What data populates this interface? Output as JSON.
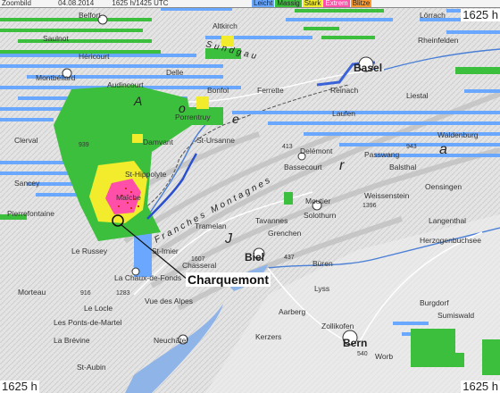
{
  "header": {
    "title": "Zoombild",
    "date": "04.08.2014",
    "time": "1625 h/1425 UTC",
    "legend": [
      {
        "label": "Leicht",
        "color": "#6aa8ff"
      },
      {
        "label": "Massig",
        "color": "#3cbf3c"
      },
      {
        "label": "Stark",
        "color": "#f2ec2c"
      },
      {
        "label": "Extrem",
        "color": "#ff4fa8"
      },
      {
        "label": "Blitze",
        "color": "#ff9a2e"
      }
    ]
  },
  "corners": {
    "top_right": "1625 h",
    "bottom_left": "1625 h",
    "bottom_right": "1625 h"
  },
  "callout": {
    "label": "Charquemont"
  },
  "places": {
    "belfort": "Belfort",
    "hericourt": "Héricourt",
    "montbeliard": "Montbéliard",
    "audincourt": "Audincourt",
    "delle": "Delle",
    "basel": "Basel",
    "lorrach": "Lörrach",
    "rheinfelden": "Rheinfelden",
    "liestal": "Liestal",
    "reinach": "Reinach",
    "laufen": "Laufen",
    "delemont": "Delémont",
    "porrentruy": "Porrentruy",
    "st_ursanne": "St-Ursanne",
    "damvant": "Damvant",
    "st_hippolyte": "St-Hippolyte",
    "maiche": "Maîche",
    "pierrefontaine": "Pierrefontaine",
    "le_russey": "Le Russey",
    "la_chaux_de_fonds": "La Chaux-de-Fonds",
    "le_locle": "Le Locle",
    "la_brevine": "La Brévine",
    "neuchatel": "Neuchâtel",
    "st_imier": "St-Imier",
    "tramelan": "Tramelan",
    "tavannes": "Tavannes",
    "moutier": "Moutier",
    "grenchen": "Grenchen",
    "solothurn": "Solothurn",
    "biel": "Biel",
    "buren": "Büren",
    "lyss": "Lyss",
    "aarberg": "Aarberg",
    "zollikofen": "Zollikofen",
    "bern": "Bern",
    "burgdorf": "Burgdorf",
    "langenthal": "Langenthal",
    "herzogenbuchsee": "Herzogenbuchsee",
    "balsthal": "Balsthal",
    "waldenburg": "Waldenburg",
    "passwang": "Passwang",
    "weissenstein": "Weissenstein",
    "oensingen": "Oensingen",
    "sumiswald": "Sumiswald",
    "chasseral": "Chasseral",
    "morteau": "Morteau",
    "sancey": "Sancey",
    "clerval": "Clerval",
    "altkirch": "Altkirch",
    "ferrette": "Ferrette",
    "bonfol": "Bonfol",
    "bassecourt": "Bassecourt",
    "saulnot": "Saulnot",
    "kerzers": "Kerzers",
    "worb": "Worb",
    "st_aubin": "St-Aubin",
    "les_ponts_de_martel": "Les Ponts-de-Martel",
    "vue_des_alpes": "Vue des Alpes",
    "franches_montagnes": "Franches Montagnes",
    "sundgau": "Sundgau",
    "jura_j": "J",
    "jura_r": "r",
    "jura_a": "a",
    "ajoie_a": "A",
    "ajoie_o": "o",
    "ajoie_e": "e",
    "elev_1607": "1607",
    "elev_1396": "1396",
    "elev_943": "943",
    "elev_939": "939",
    "elev_413": "413",
    "elev_437": "437",
    "elev_540": "540",
    "elev_916": "916",
    "elev_1283": "1283"
  }
}
